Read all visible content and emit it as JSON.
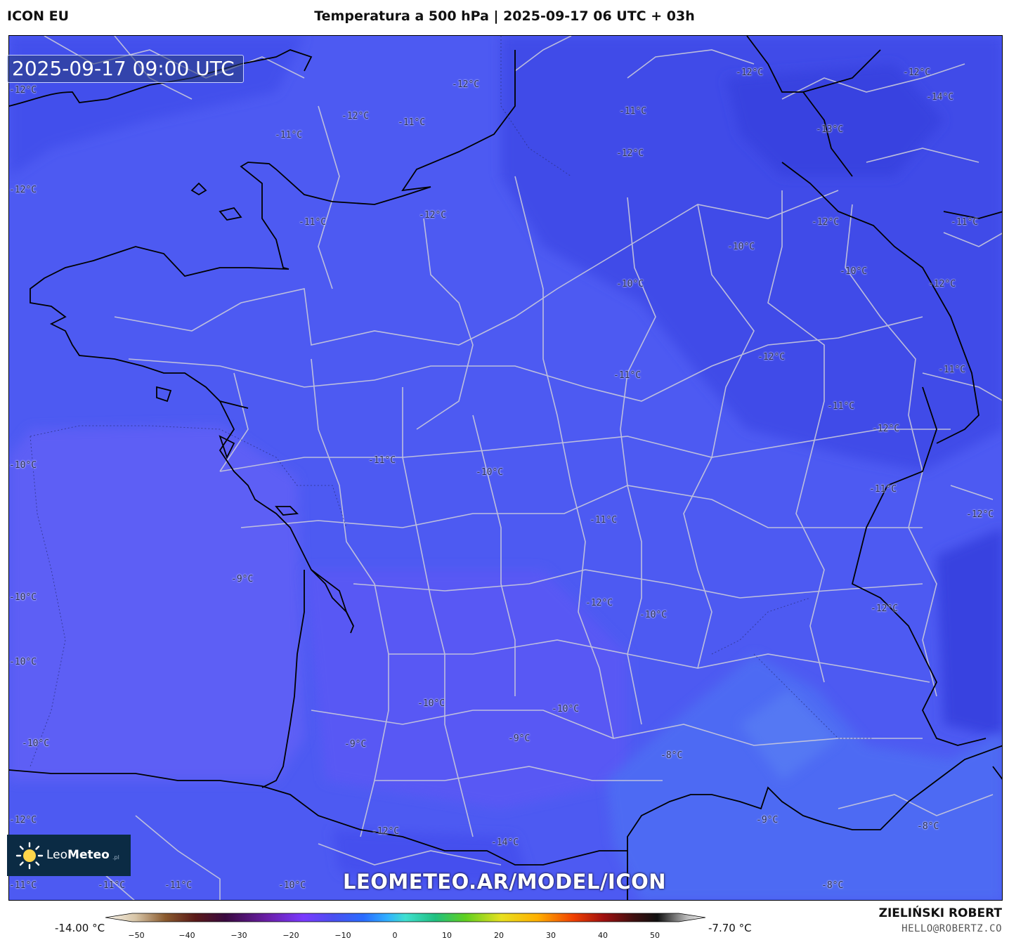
{
  "header": {
    "model": "ICON EU",
    "title": "Temperatura a 500 hPa | 2025-09-17 06 UTC + 03h"
  },
  "map": {
    "valid_time": "2025-09-17 09:00 UTC",
    "colors": {
      "background": "#4f5cf3",
      "cold": "#3a48e6",
      "mid": "#5a62f4",
      "warm": "#4a6cf2",
      "coast": "#000000",
      "borders": "#c8c8d8"
    },
    "labels": [
      "-12°C",
      "-12°C",
      "-12°C",
      "-11°C",
      "-12°C",
      "-11°C",
      "-11°C",
      "-12°C",
      "-12°C",
      "-12°C",
      "-14°C",
      "-13°C",
      "-12°C",
      "-11°C",
      "-12°C",
      "-11°C",
      "-10°C",
      "-10°C",
      "-12°C",
      "-12°C",
      "-10°C",
      "-11°C",
      "-11°C",
      "-11°C",
      "-12°C",
      "-10°C",
      "-11°C",
      "-11°C",
      "-10°C",
      "-9°C",
      "-11°C",
      "-12°C",
      "-10°C",
      "-10°C",
      "-10°C",
      "-10°C",
      "-10°C",
      "-12°C",
      "-9°C",
      "-9°C",
      "-8°C",
      "-9°C",
      "-8°C",
      "-12°C",
      "-12°C",
      "-14°C",
      "-11°C",
      "-11°C",
      "-11°C",
      "-10°C",
      "-8°C",
      "-10°C",
      "-12°C"
    ]
  },
  "logo": {
    "name_a": "Leo",
    "name_b": "Meteo",
    "suffix": ".pl",
    "icon": "sun-icon"
  },
  "watermark": "LEOMETEO.AR/MODEL/ICON",
  "colorbar": {
    "min_label": "-14.00 °C",
    "max_label": "-7.70 °C",
    "ticks": [
      "−50",
      "−40",
      "−30",
      "−20",
      "−10",
      "0",
      "10",
      "20",
      "30",
      "40",
      "50"
    ]
  },
  "footer": {
    "author": "ZIELIŃSKI ROBERT",
    "email": "HELLO@ROBERTZ.CO"
  }
}
